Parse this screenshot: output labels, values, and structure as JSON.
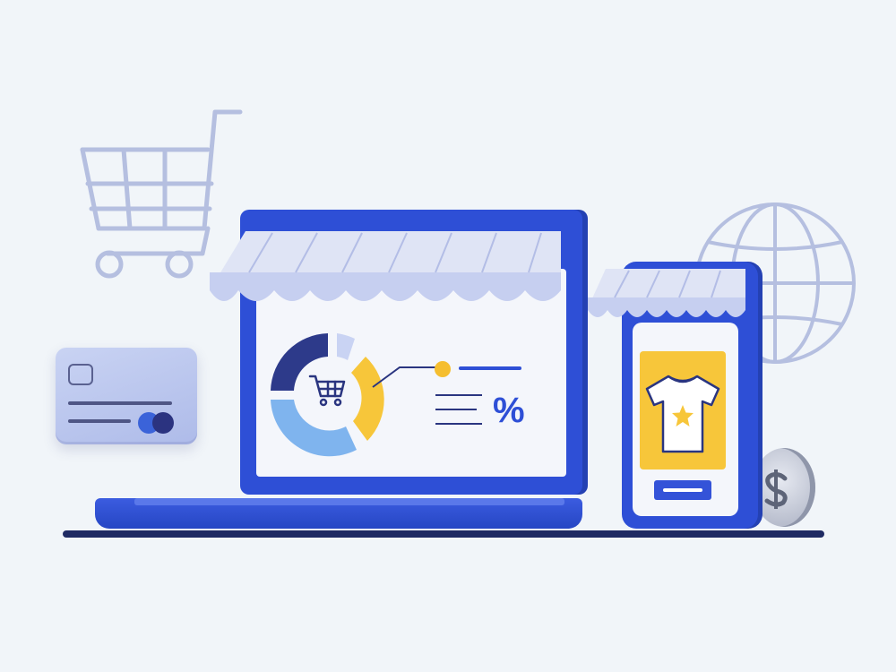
{
  "illustration": {
    "percent_symbol": "%",
    "icons": [
      "shopping-cart-icon",
      "credit-card-icon",
      "globe-icon",
      "laptop-icon",
      "smartphone-icon",
      "shop-awning-icon",
      "donut-chart-icon",
      "t-shirt-icon",
      "star-icon",
      "dollar-coin-icon"
    ]
  },
  "colors": {
    "background": "#f1f5f9",
    "primary_blue": "#2e4fd6",
    "dark_blue": "#2441b3",
    "navy": "#1f2a63",
    "yellow": "#f7c63a",
    "light_lavender": "#c9d3f3",
    "light_blue": "#7fb4ee",
    "gray_outline": "#b5bfe0"
  }
}
